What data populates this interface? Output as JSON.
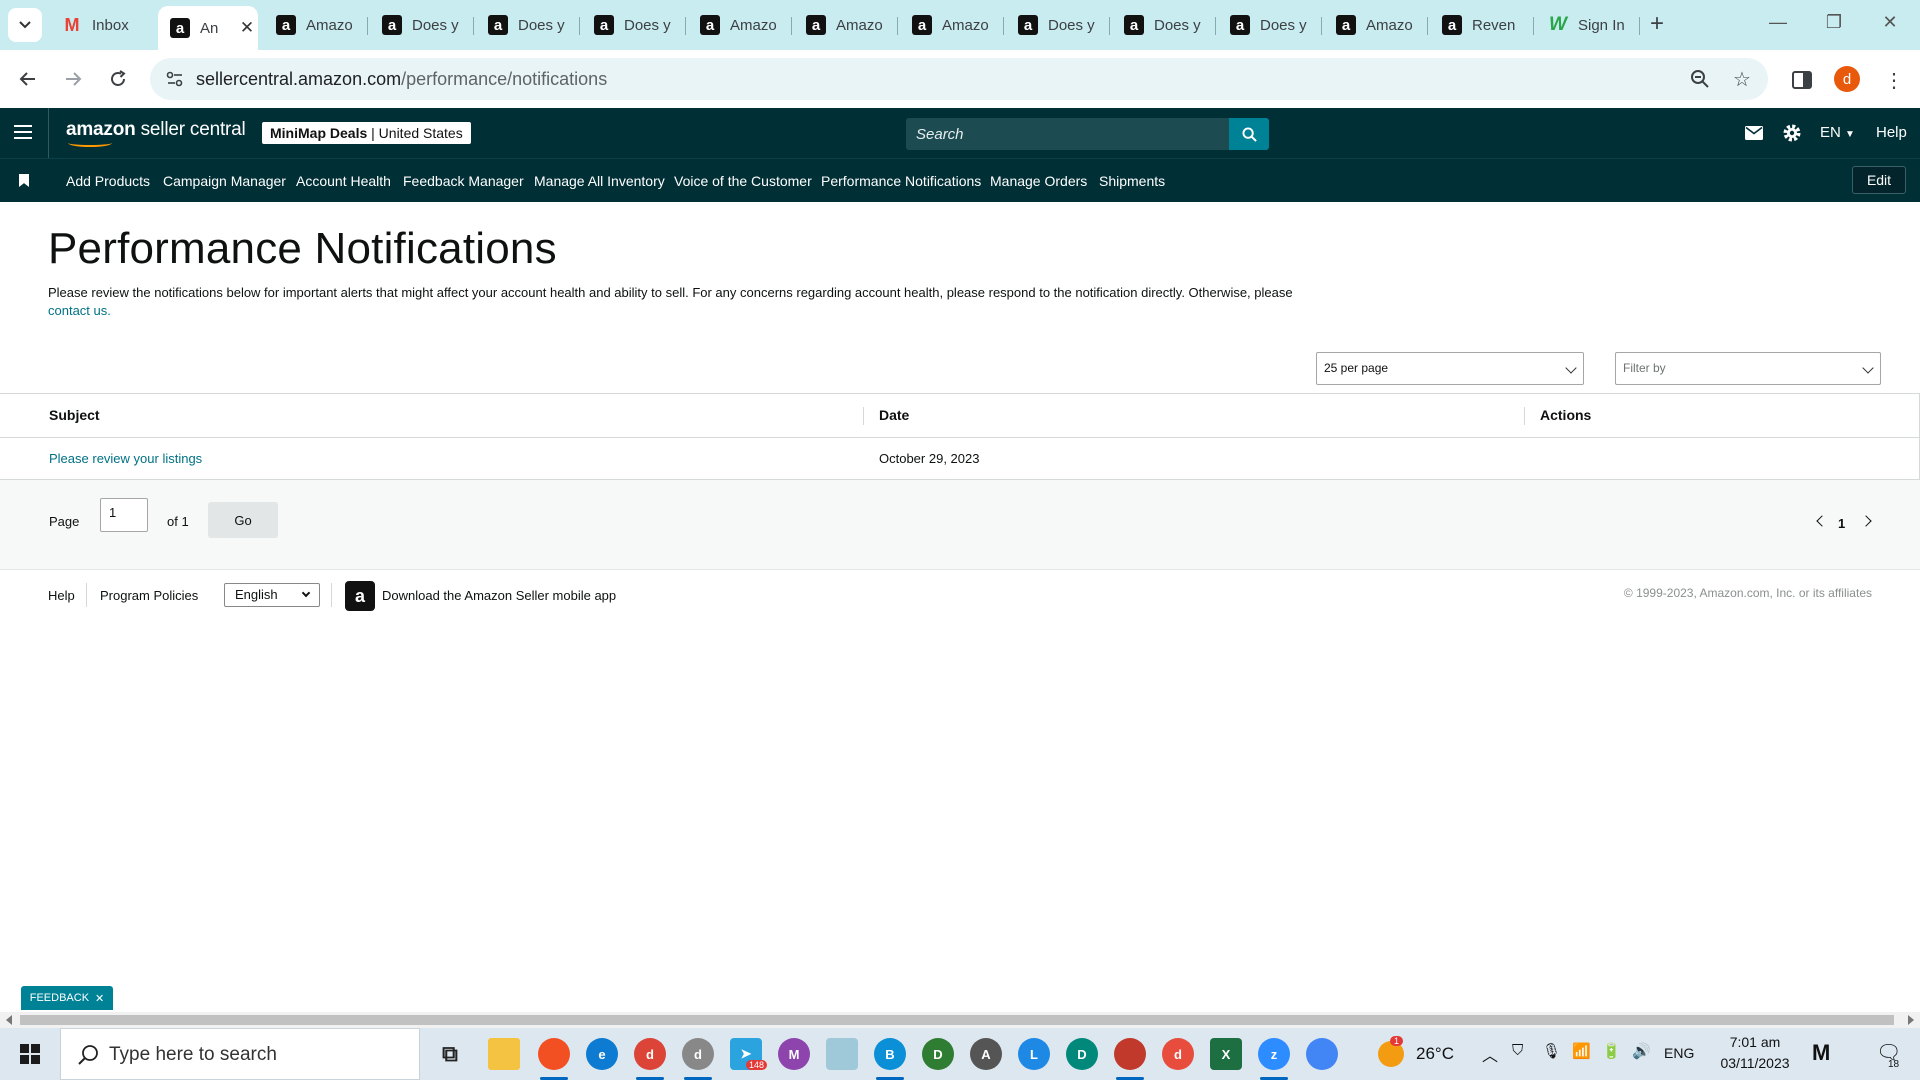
{
  "browser": {
    "tabs": [
      {
        "title": "Inbox",
        "favicon": "gmail-icon",
        "active": false
      },
      {
        "title": "An",
        "favicon": "amazon-icon",
        "active": true
      },
      {
        "title": "Amazo",
        "favicon": "amazon-icon",
        "active": false
      },
      {
        "title": "Does y",
        "favicon": "amazon-icon",
        "active": false
      },
      {
        "title": "Does y",
        "favicon": "amazon-icon",
        "active": false
      },
      {
        "title": "Does y",
        "favicon": "amazon-icon",
        "active": false
      },
      {
        "title": "Amazo",
        "favicon": "amazon-icon",
        "active": false
      },
      {
        "title": "Amazo",
        "favicon": "amazon-icon",
        "active": false
      },
      {
        "title": "Amazo",
        "favicon": "amazon-icon",
        "active": false
      },
      {
        "title": "Does y",
        "favicon": "amazon-icon",
        "active": false
      },
      {
        "title": "Does y",
        "favicon": "amazon-icon",
        "active": false
      },
      {
        "title": "Does y",
        "favicon": "amazon-icon",
        "active": false
      },
      {
        "title": "Amazo",
        "favicon": "amazon-icon",
        "active": false
      },
      {
        "title": "Reven",
        "favicon": "amazon-icon",
        "active": false
      },
      {
        "title": "Sign In",
        "favicon": "w-icon",
        "active": false
      }
    ],
    "url_domain": "sellercentral.amazon.com",
    "url_path": "/performance/notifications",
    "profile_initial": "d"
  },
  "header": {
    "logo_bold": "amazon",
    "logo_rest": " seller central",
    "store_name": "MiniMap Deals",
    "store_sep": " | ",
    "store_region": "United States",
    "search_placeholder": "Search",
    "language": "EN",
    "help": "Help"
  },
  "nav": {
    "links": [
      "Add Products",
      "Campaign Manager",
      "Account Health",
      "Feedback Manager",
      "Manage All Inventory",
      "Voice of the Customer",
      "Performance Notifications",
      "Manage Orders",
      "Shipments"
    ],
    "edit": "Edit"
  },
  "page": {
    "title": "Performance Notifications",
    "description": "Please review the notifications below for important alerts that might affect your account health and ability to sell. For any concerns regarding account health, please respond to the notification directly. Otherwise, please ",
    "contact_link": "contact us.",
    "per_page": "25 per page",
    "filter_placeholder": "Filter by"
  },
  "table": {
    "headers": [
      "Subject",
      "Date",
      "Actions"
    ],
    "rows": [
      {
        "subject": "Please review your listings",
        "date": "October 29, 2023",
        "actions": ""
      }
    ]
  },
  "pager": {
    "page_label": "Page",
    "current": "1",
    "of_label": "of 1",
    "go": "Go",
    "page_number": "1"
  },
  "footer": {
    "help": "Help",
    "program_policies": "Program Policies",
    "language": "English",
    "app_text": "Download the Amazon Seller mobile app",
    "copyright": "© 1999-2023, Amazon.com, Inc. or its affiliates"
  },
  "feedback": "FEEDBACK",
  "taskbar": {
    "search_placeholder": "Type here to search",
    "weather_temp": "26°C",
    "weather_badge": "1",
    "telegram_badge": "148",
    "language": "ENG",
    "time": "7:01 am",
    "date": "03/11/2023",
    "notification_count": "18"
  },
  "colors": {
    "header_bg": "#002f36",
    "accent": "#008296",
    "link": "#007185",
    "tabstrip": "#c9ecf1"
  }
}
